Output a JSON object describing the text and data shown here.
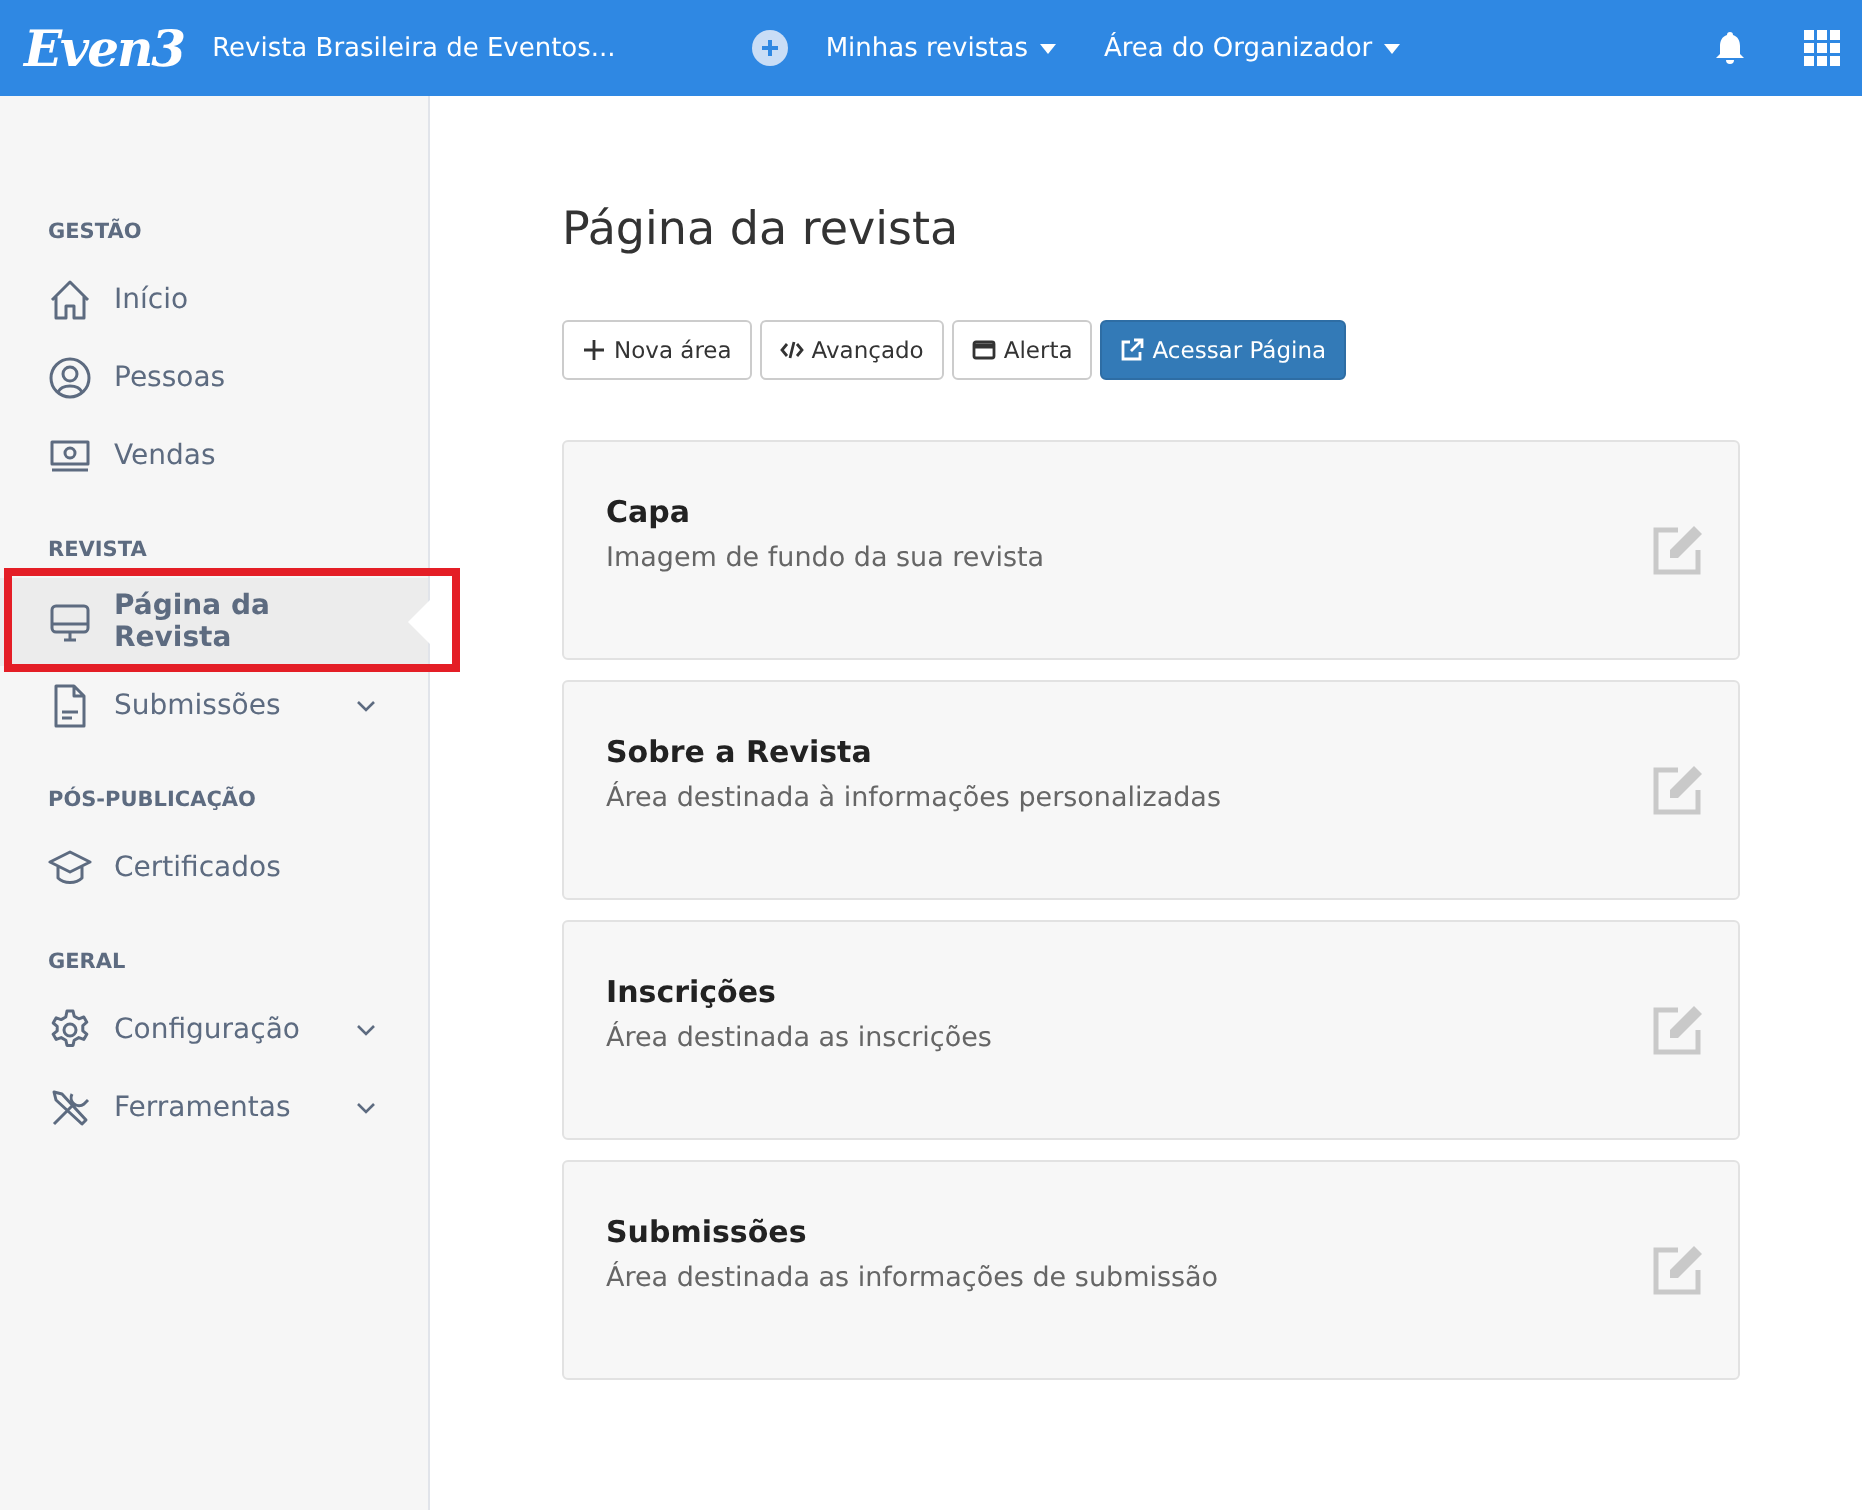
{
  "topbar": {
    "logo": "Even3",
    "title": "Revista Brasileira de Eventos...",
    "menus": [
      {
        "label": "Minhas revistas"
      },
      {
        "label": "Área do Organizador"
      }
    ]
  },
  "sidebar": {
    "sections": [
      {
        "title": "GESTÃO",
        "items": [
          {
            "label": "Início",
            "kind": "home",
            "selected": false,
            "expandable": false,
            "highlighted": false
          },
          {
            "label": "Pessoas",
            "kind": "person",
            "selected": false,
            "expandable": false,
            "highlighted": false
          },
          {
            "label": "Vendas",
            "kind": "money",
            "selected": false,
            "expandable": false,
            "highlighted": false
          }
        ]
      },
      {
        "title": "REVISTA",
        "items": [
          {
            "label": "Página da Revista",
            "kind": "monitor",
            "selected": true,
            "expandable": false,
            "highlighted": true
          },
          {
            "label": "Submissões",
            "kind": "document",
            "selected": false,
            "expandable": true,
            "highlighted": false
          }
        ]
      },
      {
        "title": "PÓS-PUBLICAÇÃO",
        "items": [
          {
            "label": "Certificados",
            "kind": "cap",
            "selected": false,
            "expandable": false,
            "highlighted": false
          }
        ]
      },
      {
        "title": "GERAL",
        "items": [
          {
            "label": "Configuração",
            "kind": "gear",
            "selected": false,
            "expandable": true,
            "highlighted": false
          },
          {
            "label": "Ferramentas",
            "kind": "tools",
            "selected": false,
            "expandable": true,
            "highlighted": false
          }
        ]
      }
    ]
  },
  "page": {
    "title": "Página da revista",
    "buttons": [
      {
        "label": "Nova área",
        "kind": "plus",
        "primary": false
      },
      {
        "label": "Avançado",
        "kind": "code",
        "primary": false
      },
      {
        "label": "Alerta",
        "kind": "window",
        "primary": false
      },
      {
        "label": "Acessar Página",
        "kind": "external",
        "primary": true
      }
    ],
    "cards": [
      {
        "title": "Capa",
        "description": "Imagem de fundo da sua revista"
      },
      {
        "title": "Sobre a Revista",
        "description": "Área destinada à informações personalizadas"
      },
      {
        "title": "Inscrições",
        "description": "Área destinada as inscrições"
      },
      {
        "title": "Submissões",
        "description": "Área destinada as informações de submissão"
      }
    ]
  }
}
